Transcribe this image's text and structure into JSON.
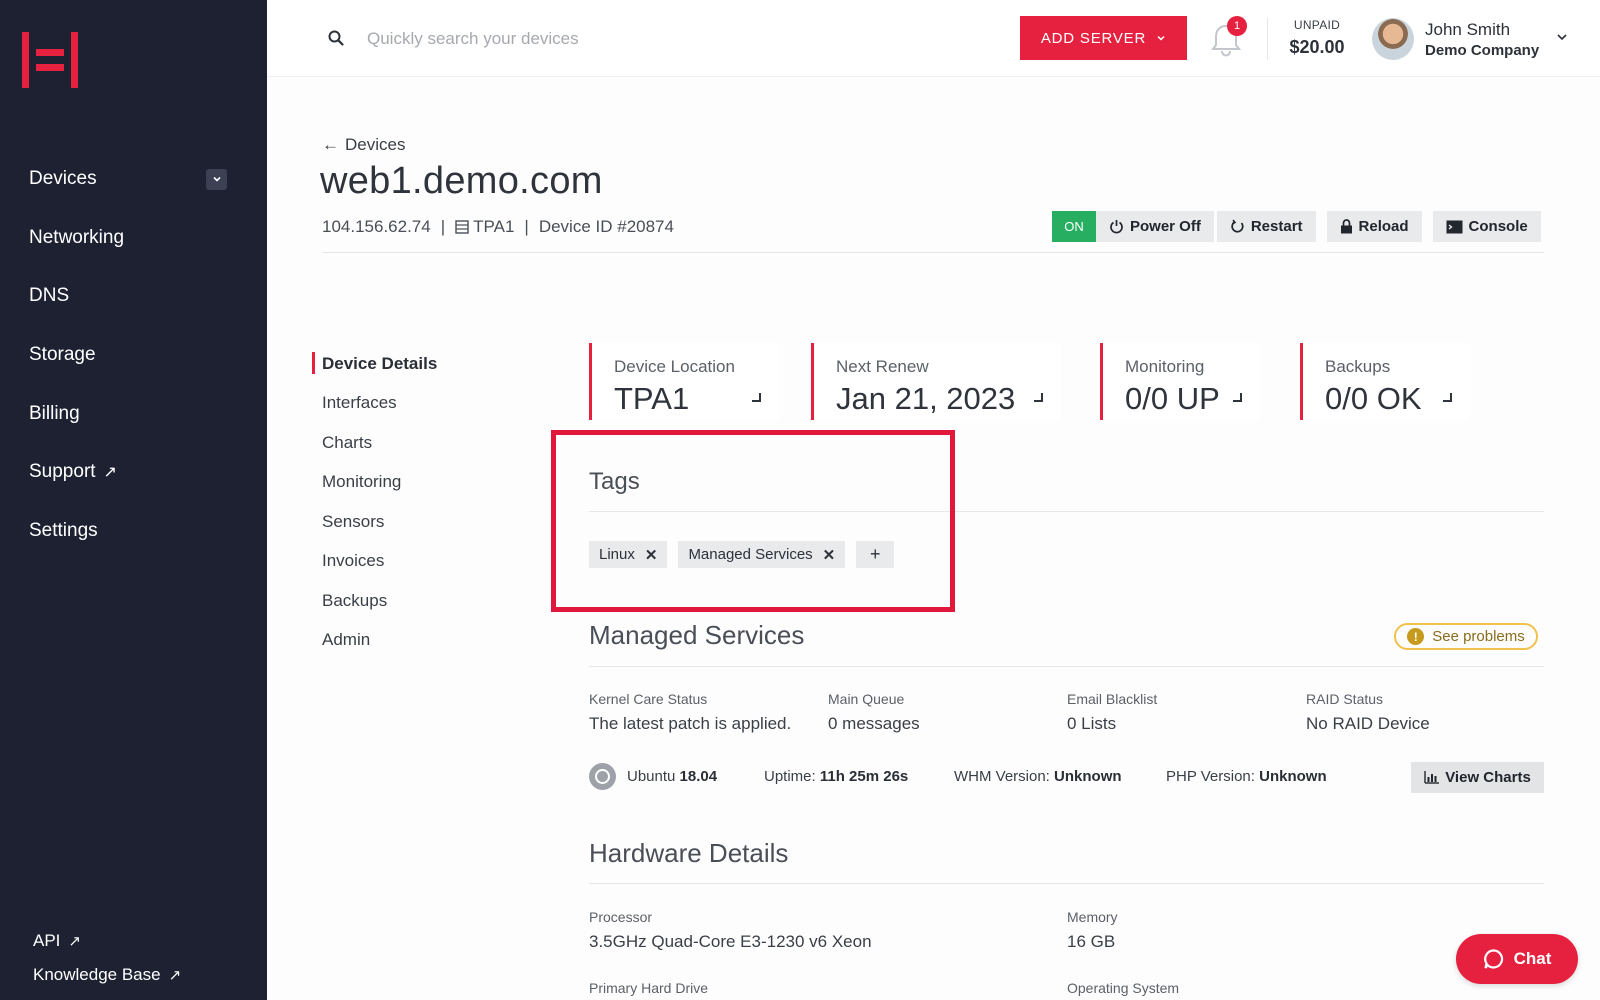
{
  "sidebar": {
    "items": [
      {
        "label": "Devices"
      },
      {
        "label": "Networking"
      },
      {
        "label": "DNS"
      },
      {
        "label": "Storage"
      },
      {
        "label": "Billing"
      },
      {
        "label": "Support"
      },
      {
        "label": "Settings"
      }
    ],
    "bottom_links": [
      {
        "label": "API"
      },
      {
        "label": "Knowledge Base"
      }
    ]
  },
  "topbar": {
    "search_placeholder": "Quickly search your devices",
    "add_server_label": "ADD SERVER",
    "notification_count": "1",
    "unpaid_label": "UNPAID",
    "unpaid_amount": "$20.00",
    "user_name": "John Smith",
    "user_company": "Demo Company"
  },
  "header": {
    "back_label": "Devices",
    "title": "web1.demo.com",
    "ip": "104.156.62.74",
    "sep": "|",
    "location": "TPA1",
    "device_id": "Device ID #20874",
    "status": "ON",
    "actions": [
      "Power Off",
      "Restart",
      "Reload",
      "Console"
    ]
  },
  "tabs": [
    {
      "label": "Device Details",
      "active": true
    },
    {
      "label": "Interfaces"
    },
    {
      "label": "Charts"
    },
    {
      "label": "Monitoring"
    },
    {
      "label": "Sensors"
    },
    {
      "label": "Invoices"
    },
    {
      "label": "Backups"
    },
    {
      "label": "Admin"
    }
  ],
  "stats": [
    {
      "label": "Device Location",
      "value": "TPA1"
    },
    {
      "label": "Next Renew",
      "value": "Jan 21, 2023"
    },
    {
      "label": "Monitoring",
      "value": "0/0 UP"
    },
    {
      "label": "Backups",
      "value": "0/0 OK"
    }
  ],
  "tags": {
    "title": "Tags",
    "items": [
      "Linux",
      "Managed Services"
    ],
    "add_label": "+"
  },
  "managed_services": {
    "title": "Managed Services",
    "see_problems": "See problems",
    "fields": [
      {
        "key": "Kernel Care Status",
        "value": "The latest patch is applied."
      },
      {
        "key": "Main Queue",
        "value": "0 messages"
      },
      {
        "key": "Email Blacklist",
        "value": "0 Lists"
      },
      {
        "key": "RAID Status",
        "value": "No RAID Device"
      }
    ],
    "os_name": "Ubuntu",
    "os_version": "18.04",
    "uptime_label": "Uptime:",
    "uptime_value": "11h 25m 26s",
    "whm_label": "WHM Version:",
    "whm_value": "Unknown",
    "php_label": "PHP Version:",
    "php_value": "Unknown",
    "view_charts": "View Charts"
  },
  "hardware": {
    "title": "Hardware Details",
    "fields": [
      {
        "key": "Processor",
        "value": "3.5GHz Quad-Core E3-1230 v6 Xeon"
      },
      {
        "key": "Memory",
        "value": "16 GB"
      },
      {
        "key": "Primary Hard Drive",
        "value": ""
      },
      {
        "key": "Operating System",
        "value": ""
      }
    ]
  },
  "chat_label": "Chat",
  "colors": {
    "sidebar_bg": "#1d2132",
    "accent": "#e5213f",
    "status_on": "#27ae60",
    "warning": "#f0c14b"
  }
}
